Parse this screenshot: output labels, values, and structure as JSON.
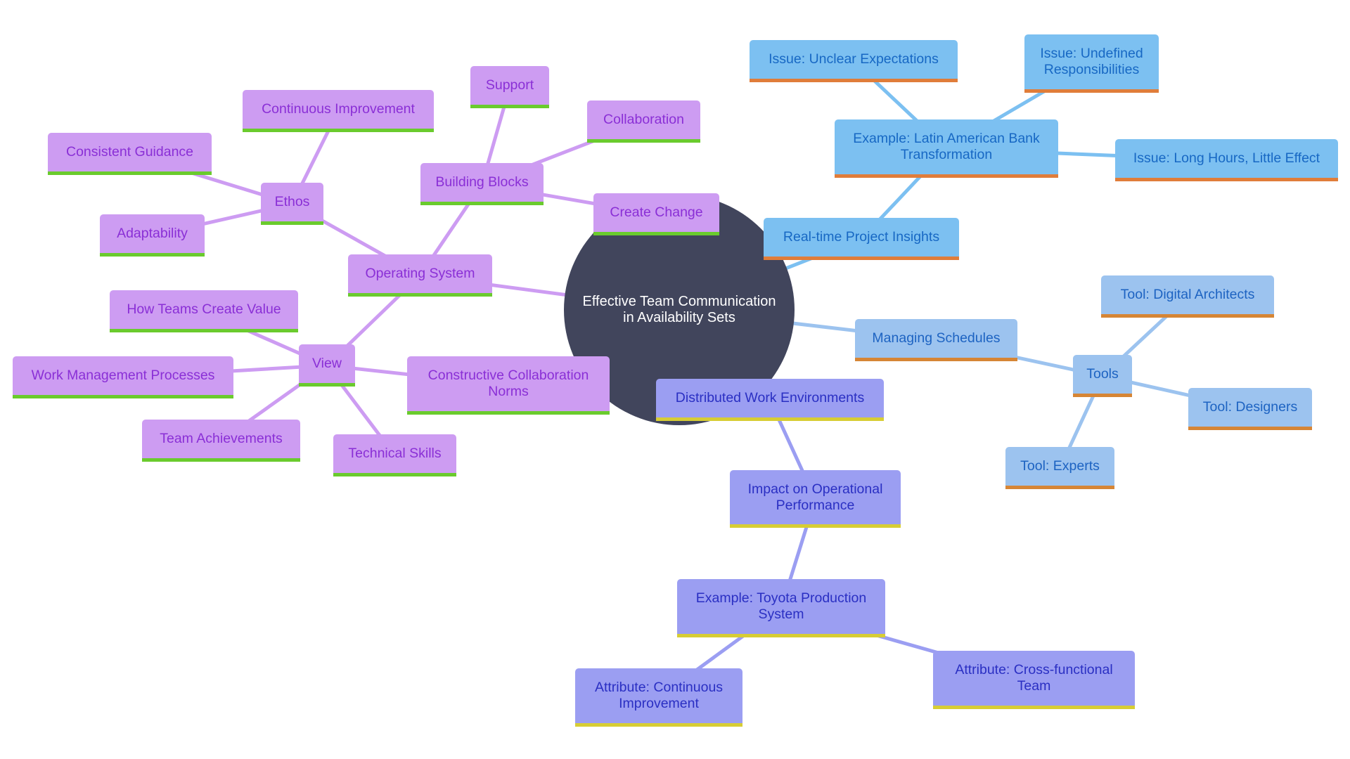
{
  "diagram": {
    "type": "mindmap",
    "root": {
      "id": "root",
      "label": "Effective Team Communication\nin Availability Sets"
    },
    "colors": {
      "root_fill": "#41455c",
      "purple_branch": "#cd9cf2",
      "purple_accent": "#6acb2d",
      "blue_branch": "#7cc0f1",
      "blue_branch_alt": "#9cc3ef",
      "blue_accent": "#e07d3a",
      "periwinkle_branch": "#9b9ef2",
      "periwinkle_accent": "#d7cd34"
    },
    "nodes": [
      {
        "id": "operating-system",
        "label": "Operating System",
        "parent": "root",
        "branch": "purple"
      },
      {
        "id": "ethos",
        "label": "Ethos",
        "parent": "operating-system",
        "branch": "purple"
      },
      {
        "id": "continuous-improvement",
        "label": "Continuous Improvement",
        "parent": "ethos",
        "branch": "purple"
      },
      {
        "id": "consistent-guidance",
        "label": "Consistent Guidance",
        "parent": "ethos",
        "branch": "purple"
      },
      {
        "id": "adaptability",
        "label": "Adaptability",
        "parent": "ethos",
        "branch": "purple"
      },
      {
        "id": "building-blocks",
        "label": "Building Blocks",
        "parent": "operating-system",
        "branch": "purple"
      },
      {
        "id": "support",
        "label": "Support",
        "parent": "building-blocks",
        "branch": "purple"
      },
      {
        "id": "collaboration",
        "label": "Collaboration",
        "parent": "building-blocks",
        "branch": "purple"
      },
      {
        "id": "create-change",
        "label": "Create Change",
        "parent": "building-blocks",
        "branch": "purple"
      },
      {
        "id": "view",
        "label": "View",
        "parent": "operating-system",
        "branch": "purple"
      },
      {
        "id": "how-teams-create-value",
        "label": "How Teams Create Value",
        "parent": "view",
        "branch": "purple"
      },
      {
        "id": "work-management-processes",
        "label": "Work Management Processes",
        "parent": "view",
        "branch": "purple"
      },
      {
        "id": "team-achievements",
        "label": "Team Achievements",
        "parent": "view",
        "branch": "purple"
      },
      {
        "id": "technical-skills",
        "label": "Technical Skills",
        "parent": "view",
        "branch": "purple"
      },
      {
        "id": "constructive-collaboration-norms",
        "label": "Constructive Collaboration\nNorms",
        "parent": "view",
        "branch": "purple"
      },
      {
        "id": "real-time-project-insights",
        "label": "Real-time Project Insights",
        "parent": "root",
        "branch": "blue1"
      },
      {
        "id": "latin-american-bank",
        "label": "Example: Latin American Bank\nTransformation",
        "parent": "real-time-project-insights",
        "branch": "blue1"
      },
      {
        "id": "issue-unclear-expectations",
        "label": "Issue: Unclear Expectations",
        "parent": "latin-american-bank",
        "branch": "blue1"
      },
      {
        "id": "issue-undefined-responsibilities",
        "label": "Issue: Undefined\nResponsibilities",
        "parent": "latin-american-bank",
        "branch": "blue1"
      },
      {
        "id": "issue-long-hours",
        "label": "Issue: Long Hours, Little Effect",
        "parent": "latin-american-bank",
        "branch": "blue1"
      },
      {
        "id": "managing-schedules",
        "label": "Managing Schedules",
        "parent": "root",
        "branch": "blue2"
      },
      {
        "id": "tools",
        "label": "Tools",
        "parent": "managing-schedules",
        "branch": "blue2"
      },
      {
        "id": "tool-digital-architects",
        "label": "Tool: Digital Architects",
        "parent": "tools",
        "branch": "blue2"
      },
      {
        "id": "tool-designers",
        "label": "Tool: Designers",
        "parent": "tools",
        "branch": "blue2"
      },
      {
        "id": "tool-experts",
        "label": "Tool: Experts",
        "parent": "tools",
        "branch": "blue2"
      },
      {
        "id": "distributed-work-environments",
        "label": "Distributed Work Environments",
        "parent": "root",
        "branch": "peri"
      },
      {
        "id": "impact-operational-performance",
        "label": "Impact on Operational\nPerformance",
        "parent": "distributed-work-environments",
        "branch": "peri"
      },
      {
        "id": "toyota-production-system",
        "label": "Example: Toyota Production\nSystem",
        "parent": "impact-operational-performance",
        "branch": "peri"
      },
      {
        "id": "attribute-continuous-improvement",
        "label": "Attribute: Continuous\nImprovement",
        "parent": "toyota-production-system",
        "branch": "peri"
      },
      {
        "id": "attribute-cross-functional-team",
        "label": "Attribute: Cross-functional\nTeam",
        "parent": "toyota-production-system",
        "branch": "peri"
      }
    ]
  }
}
